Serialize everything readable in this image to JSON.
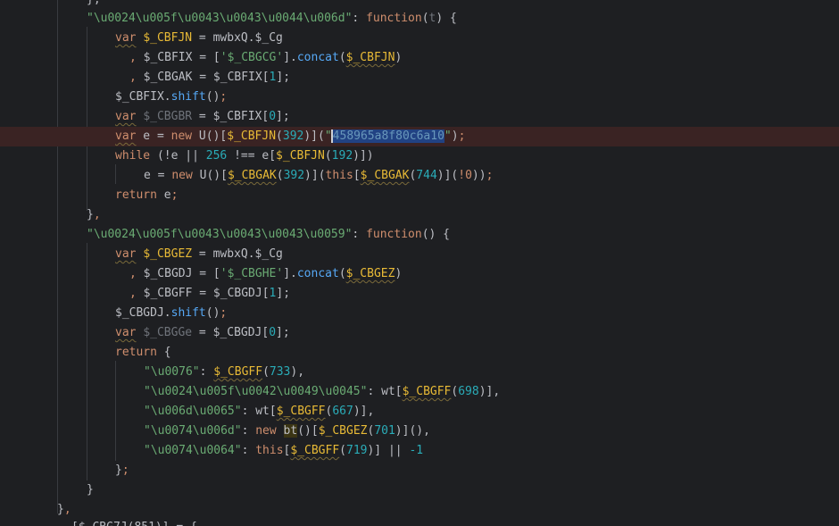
{
  "editor": {
    "lines": [
      {
        "indent": "",
        "text": "    },"
      },
      {
        "indent": "  ",
        "key": "\"\\u0024\\u005f\\u0043\\u0043\\u0044\\u006d\"",
        "rest": ": function(t) {"
      },
      {
        "text": "var $_CBFJN = mwbxQ.$_Cg"
      },
      {
        "text": ", $_CBFIX = ['$_CBGCG'].concat($_CBFJN)"
      },
      {
        "text": ", $_CBGAK = $_CBFIX[1];"
      },
      {
        "text": "$_CBFIX.shift();"
      },
      {
        "text": "var $_CBGBR = $_CBFIX[0];"
      },
      {
        "text": "var e = new U()[$_CBFJN(392)](\"458965a8f80c6a10\");"
      },
      {
        "text": "while (!e || 256 !== e[$_CBFJN(192)])"
      },
      {
        "text": "e = new U()[$_CBGAK(392)](this[$_CBGAK(744)](!0));"
      },
      {
        "text": "return e;"
      },
      {
        "text": "},"
      },
      {
        "text": "\"\\u0024\\u005f\\u0043\\u0043\\u0043\\u0059\": function() {"
      },
      {
        "text": "var $_CBGEZ = mwbxQ.$_Cg"
      },
      {
        "text": ", $_CBGDJ = ['$_CBGHE'].concat($_CBGEZ)"
      },
      {
        "text": ", $_CBGFF = $_CBGDJ[1];"
      },
      {
        "text": "$_CBGDJ.shift();"
      },
      {
        "text": "var $_CBGGe = $_CBGDJ[0];"
      },
      {
        "text": "return {"
      },
      {
        "text": "\"\\u0076\": $_CBGFF(733),"
      },
      {
        "text": "\"\\u0024\\u005f\\u0042\\u0049\\u0045\": wt[$_CBGFF(698)],"
      },
      {
        "text": "\"\\u006d\\u0065\": wt[$_CBGFF(667)],"
      },
      {
        "text": "\"\\u0074\\u006d\": new bt()[$_CBGEZ(701)](),"
      },
      {
        "text": "\"\\u0074\\u0064\": this[$_CBGFF(719)] || -1"
      },
      {
        "text": "};"
      },
      {
        "text": "}"
      },
      {
        "text": "},"
      },
      {
        "text": "[$_CBGJ(851)] = {"
      }
    ],
    "tokens": {
      "var": "var",
      "new": "new",
      "while": "while",
      "return": "return",
      "function": "function",
      "this": "this",
      "selected_hash": "458965a8f80c6a10"
    }
  }
}
